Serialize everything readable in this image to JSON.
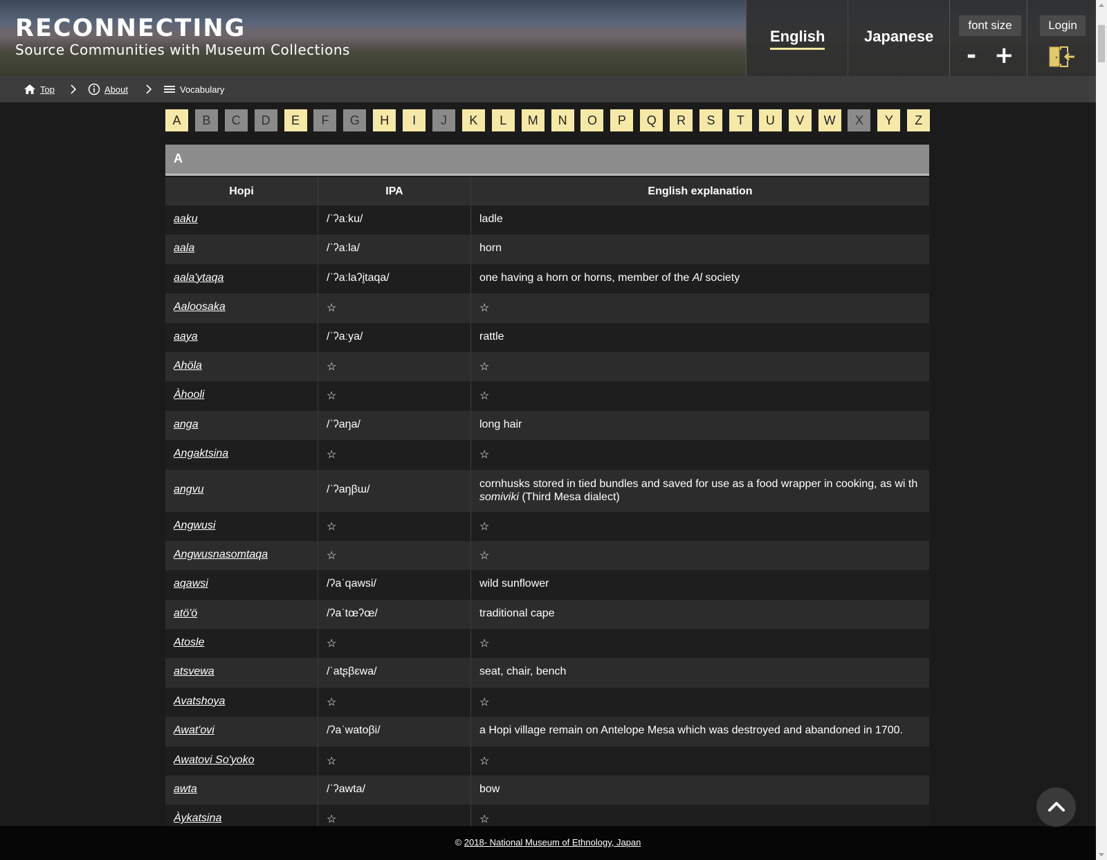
{
  "brand": {
    "title": "RECONNECTING",
    "subtitle": "Source Communities with Museum Collections"
  },
  "languages": {
    "english": "English",
    "japanese": "Japanese",
    "active": "English"
  },
  "font_size": {
    "label": "font size",
    "decrease": "-",
    "increase": "+"
  },
  "login": {
    "label": "Login"
  },
  "breadcrumb": {
    "top": "Top",
    "about": "About",
    "vocabulary": "Vocabulary"
  },
  "alphabet": [
    {
      "l": "A",
      "on": true
    },
    {
      "l": "B",
      "on": false
    },
    {
      "l": "C",
      "on": false
    },
    {
      "l": "D",
      "on": false
    },
    {
      "l": "E",
      "on": true
    },
    {
      "l": "F",
      "on": false
    },
    {
      "l": "G",
      "on": false
    },
    {
      "l": "H",
      "on": true
    },
    {
      "l": "I",
      "on": true
    },
    {
      "l": "J",
      "on": false
    },
    {
      "l": "K",
      "on": true
    },
    {
      "l": "L",
      "on": true
    },
    {
      "l": "M",
      "on": true
    },
    {
      "l": "N",
      "on": true
    },
    {
      "l": "O",
      "on": true
    },
    {
      "l": "P",
      "on": true
    },
    {
      "l": "Q",
      "on": true
    },
    {
      "l": "R",
      "on": true
    },
    {
      "l": "S",
      "on": true
    },
    {
      "l": "T",
      "on": true
    },
    {
      "l": "U",
      "on": true
    },
    {
      "l": "V",
      "on": true
    },
    {
      "l": "W",
      "on": true
    },
    {
      "l": "X",
      "on": false
    },
    {
      "l": "Y",
      "on": true
    },
    {
      "l": "Z",
      "on": true
    }
  ],
  "section": {
    "letter": "A"
  },
  "table": {
    "headers": {
      "hopi": "Hopi",
      "ipa": "IPA",
      "english": "English explanation"
    },
    "rows": [
      {
        "hopi": "aaku",
        "ipa": "/ˈʔaːku/",
        "en": "ladle"
      },
      {
        "hopi": "aala",
        "ipa": "/ˈʔaːla/",
        "en": "horn"
      },
      {
        "hopi": "aala'ytaqa",
        "ipa": "/ˈʔaːlaʔi̥taqa/",
        "en_pre": "one having a horn or horns, member of the ",
        "en_em": "Al",
        "en_post": " society"
      },
      {
        "hopi": "Aaloosaka",
        "ipa": "☆",
        "en": "☆"
      },
      {
        "hopi": "aaya",
        "ipa": "/ˈʔaːya/",
        "en": "rattle"
      },
      {
        "hopi": "Ahöla",
        "ipa": "☆",
        "en": "☆"
      },
      {
        "hopi": "Àhooli",
        "ipa": "☆",
        "en": "☆"
      },
      {
        "hopi": "anga",
        "ipa": "/ˈʔaŋa/",
        "en": "long hair"
      },
      {
        "hopi": "Angaktsina",
        "ipa": "☆",
        "en": "☆"
      },
      {
        "hopi": "angvu",
        "ipa": "/ˈʔaŋβɯ/",
        "en_pre": "cornhusks stored in tied bundles and saved for use as a food wrapper in cooking, as wi th ",
        "en_em": "somiviki",
        "en_post": " (Third Mesa dialect)",
        "tall": true
      },
      {
        "hopi": "Angwusi",
        "ipa": "☆",
        "en": "☆"
      },
      {
        "hopi": "Angwusnasomtaqa",
        "ipa": "☆",
        "en": "☆"
      },
      {
        "hopi": "aqawsi",
        "ipa": "/ʔaˈqawsi/",
        "en": "wild sunflower"
      },
      {
        "hopi": "atö'ö",
        "ipa": "/ʔaˈtœʔœ/",
        "en": "traditional cape"
      },
      {
        "hopi": "Atosle",
        "ipa": "☆",
        "en": "☆"
      },
      {
        "hopi": "atsvewa",
        "ipa": "/ˈatʂβɛwa/",
        "en": "seat, chair, bench"
      },
      {
        "hopi": "Avatshoya",
        "ipa": "☆",
        "en": "☆"
      },
      {
        "hopi": "Awat'ovi",
        "ipa": "/ʔaˈwatoβi/",
        "en": "a Hopi village remain on Antelope Mesa which was destroyed and abandoned in 1700."
      },
      {
        "hopi": "Awatovi So'yoko",
        "ipa": "☆",
        "en": "☆"
      },
      {
        "hopi": "awta",
        "ipa": "/ˈʔawta/",
        "en": "bow"
      },
      {
        "hopi": "Àykatsina",
        "ipa": "☆",
        "en": "☆"
      }
    ]
  },
  "footer": {
    "copy": "© ",
    "link": "2018- National Museum of Ethnology, Japan"
  },
  "colors": {
    "accent": "#f6e9a8",
    "disabled": "#8a8a8a",
    "login_icon": "#e2c96a"
  },
  "icons": {
    "home": "home-icon",
    "info": "info-icon",
    "list": "list-icon",
    "login": "door-login-icon",
    "to_top": "chevron-up-icon"
  }
}
